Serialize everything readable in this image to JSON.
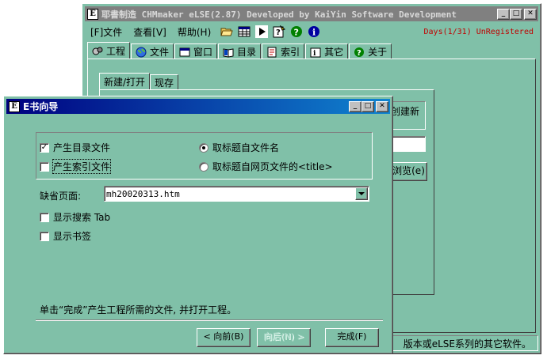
{
  "main_window": {
    "title": "耶書制造 CHMmaker eLSE(2.87) Developed by KaiYin Software Development",
    "menu": [
      "[F]文件",
      "查看[V]",
      "帮助(H)"
    ],
    "toolbar_icons": [
      "open-folder-icon",
      "grid-icon",
      "play-icon",
      "help-pointer-icon",
      "question-icon",
      "info-icon"
    ],
    "reg_info": "Days(1/31) UnRegistered",
    "tabs": [
      {
        "label": "工程",
        "icon": "project-icon"
      },
      {
        "label": "文件",
        "icon": "globe-icon"
      },
      {
        "label": "窗口",
        "icon": "window-icon"
      },
      {
        "label": "目录",
        "icon": "book-icon"
      },
      {
        "label": "索引",
        "icon": "index-icon"
      },
      {
        "label": "其它",
        "icon": "other-icon"
      },
      {
        "label": "关于",
        "icon": "question-icon"
      }
    ],
    "inner_tabs": [
      "新建/打开",
      "现存"
    ],
    "create_new_text": "创建新",
    "browse_label": "浏览(e)",
    "status": "版本或eLSE系列的其它软件。"
  },
  "wizard": {
    "title": "E书向导",
    "gen_toc": {
      "label": "产生目录文件",
      "checked": true
    },
    "gen_index": {
      "label": "产生索引文件",
      "checked": false
    },
    "title_from_filename": {
      "label": "取标题自文件名",
      "selected": true
    },
    "title_from_page": {
      "label": "取标题自网页文件的<title>",
      "selected": false
    },
    "default_page_label": "缺省页面:",
    "default_page_value": "mh20020313.htm",
    "show_search": {
      "label": "显示搜索 Tab",
      "checked": false
    },
    "show_bookmarks": {
      "label": "显示书签",
      "checked": false
    },
    "hint": "单击“完成”产生工程所需的文件, 并打开工程。",
    "back_label": "< 向前(B)",
    "next_label": "向后(N) >",
    "finish_label": "完成(F)"
  },
  "colors": {
    "face": "#80c0a8",
    "active_title": "#000080",
    "inactive_title": "#808080",
    "reg_text": "#c00000"
  }
}
